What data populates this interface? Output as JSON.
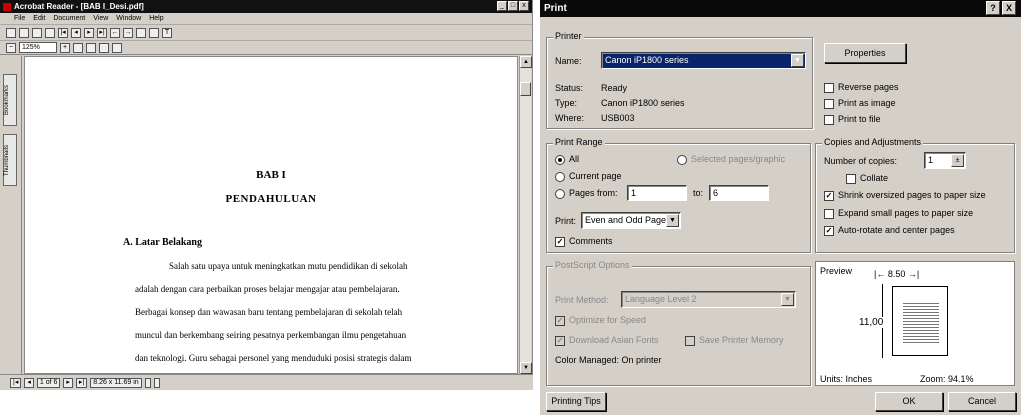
{
  "acrobat": {
    "title": "Acrobat Reader - [BAB I_Desi.pdf]",
    "menu": [
      "File",
      "Edit",
      "Document",
      "View",
      "Window",
      "Help"
    ],
    "zoom": "125%",
    "tabs": [
      "Bookmarks",
      "Thumbnails"
    ],
    "page": {
      "chapter": "BAB I",
      "chapter_title": "PENDAHULUAN",
      "section": "A.  Latar Belakang",
      "lines": [
        "Salah satu upaya untuk meningkatkan mutu pendidikan di sekolah",
        "adalah dengan cara perbaikan proses belajar mengajar atau pembelajaran.",
        "Berbagai konsep dan wawasan baru tentang pembelajaran di sekolah telah",
        "muncul dan berkembang seiring pesatnya perkembangan ilmu pengetahuan",
        "dan teknologi. Guru sebagai personel yang menduduki posisi strategis dalam"
      ]
    },
    "status": {
      "page": "1 of 6",
      "size": "8.26 x 11.69 in"
    }
  },
  "dialog": {
    "title": "Print",
    "help": "?",
    "close": "X",
    "printer": {
      "group": "Printer",
      "name_label": "Name:",
      "name_value": "Canon iP1800 series",
      "status_label": "Status:",
      "status_value": "Ready",
      "type_label": "Type:",
      "type_value": "Canon iP1800 series",
      "where_label": "Where:",
      "where_value": "USB003",
      "properties": "Properties",
      "reverse": "Reverse pages",
      "as_image": "Print as image",
      "to_file": "Print to file"
    },
    "range": {
      "group": "Print Range",
      "all": "All",
      "selected": "Selected pages/graphic",
      "current": "Current page",
      "pages_from": "Pages from:",
      "from_value": "1",
      "to_label": "to:",
      "to_value": "6",
      "print_label": "Print:",
      "print_value": "Even and Odd Pages",
      "comments": "Comments"
    },
    "copies": {
      "group": "Copies and Adjustments",
      "num_label": "Number of copies:",
      "num_value": "1",
      "collate": "Collate",
      "shrink": "Shrink oversized pages to paper size",
      "expand": "Expand small pages to paper size",
      "autorotate": "Auto-rotate and center pages"
    },
    "postscript": {
      "group": "PostScript Options",
      "method_label": "Print Method:",
      "method_value": "Language Level 2",
      "optimize": "Optimize for Speed",
      "download": "Download Asian Fonts",
      "save_mem": "Save Printer Memory",
      "managed": "Color Managed:  On printer"
    },
    "preview": {
      "label": "Preview",
      "width": "8.50",
      "height": "11,00",
      "units": "Units: Inches",
      "zoom": "Zoom: 94.1%"
    },
    "buttons": {
      "tips": "Printing Tips",
      "ok": "OK",
      "cancel": "Cancel"
    }
  }
}
